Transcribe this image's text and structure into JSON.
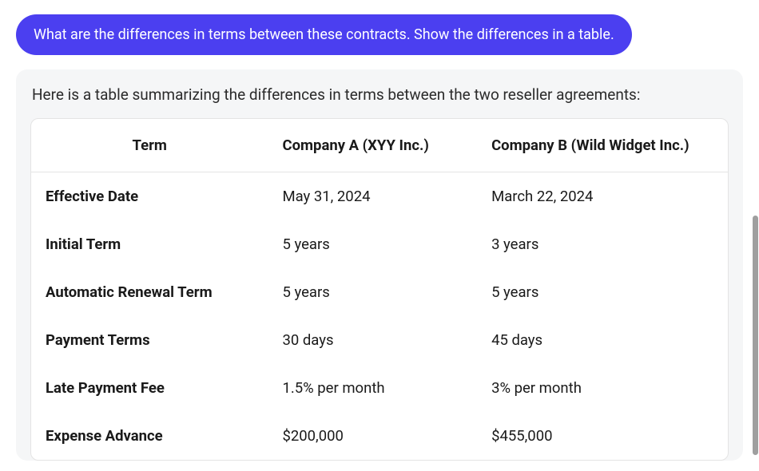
{
  "user_message": "What are the differences in terms between these contracts. Show the differences in a table.",
  "assistant_intro": "Here is a table summarizing the differences in terms between the two reseller agreements:",
  "table": {
    "headers": [
      "Term",
      "Company A (XYY Inc.)",
      "Company B (Wild Widget Inc.)"
    ],
    "rows": [
      [
        "Effective Date",
        "May 31, 2024",
        "March 22, 2024"
      ],
      [
        "Initial Term",
        "5 years",
        "3 years"
      ],
      [
        "Automatic Renewal Term",
        "5 years",
        "5 years"
      ],
      [
        "Payment Terms",
        "30 days",
        "45 days"
      ],
      [
        "Late Payment Fee",
        "1.5% per month",
        "3% per month"
      ],
      [
        "Expense Advance",
        "$200,000",
        "$455,000"
      ]
    ]
  }
}
